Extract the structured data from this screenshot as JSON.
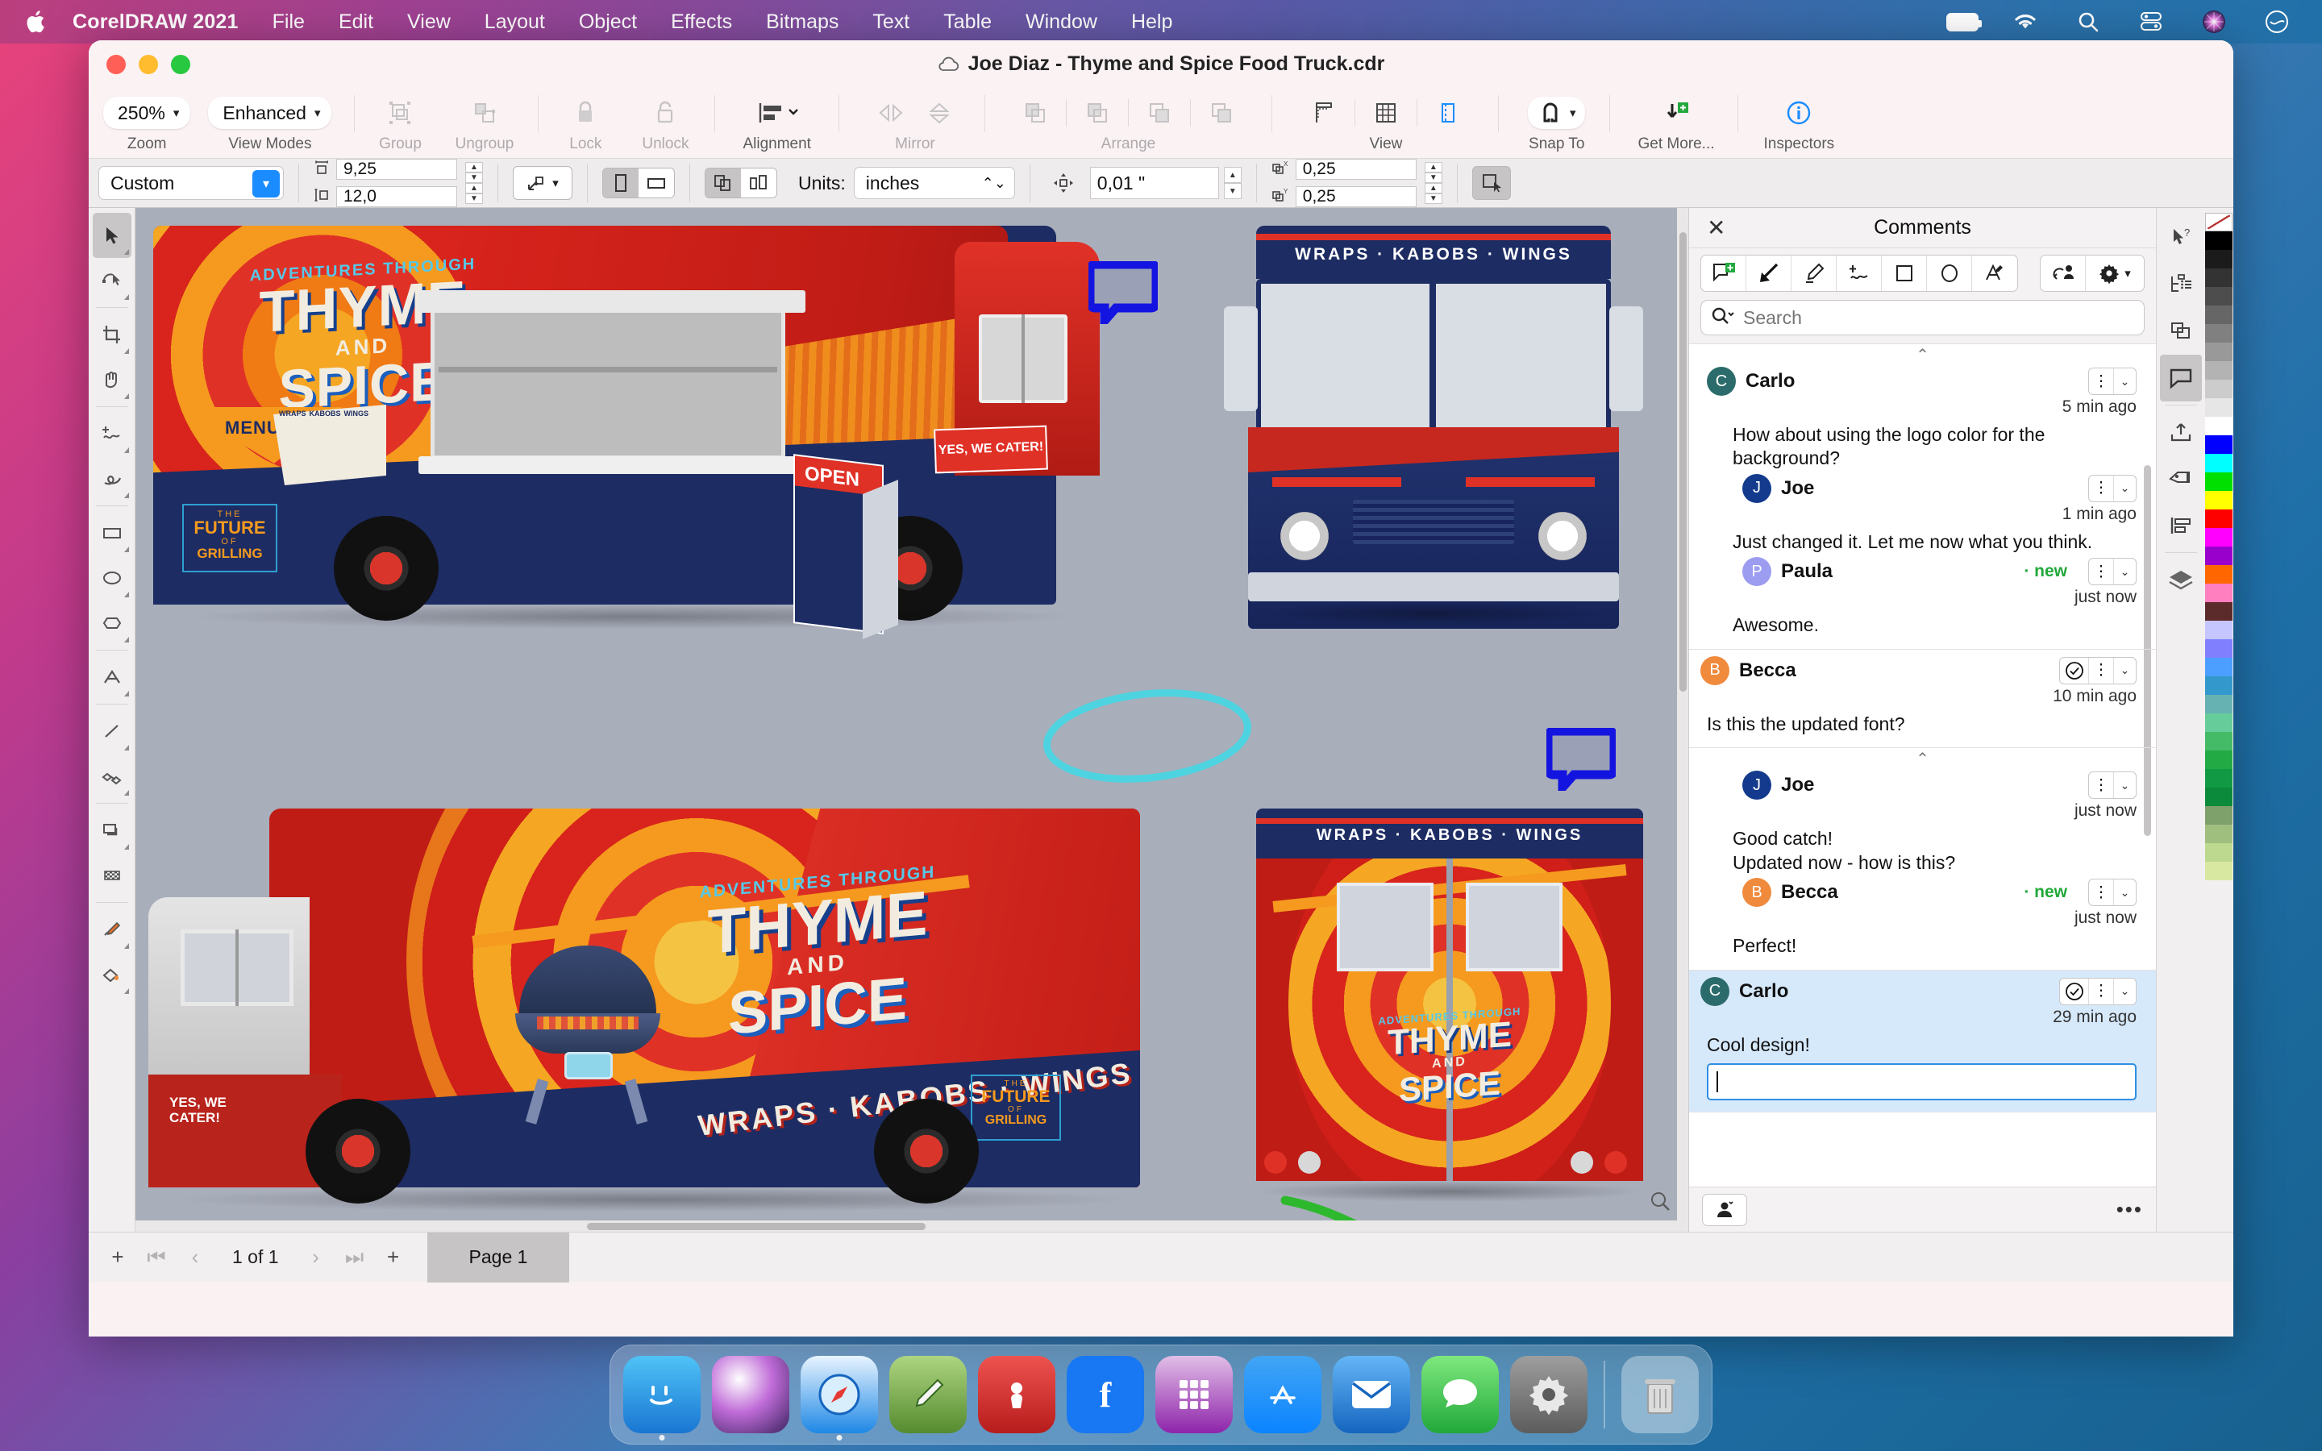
{
  "menubar": {
    "apple_icon": "apple-logo",
    "app_name": "CorelDRAW 2021",
    "items": [
      "File",
      "Edit",
      "View",
      "Layout",
      "Object",
      "Effects",
      "Bitmaps",
      "Text",
      "Table",
      "Window",
      "Help"
    ],
    "status_icons": [
      "battery-icon",
      "wifi-icon",
      "search-icon",
      "control-center-icon",
      "siri-icon",
      "notification-center-icon"
    ]
  },
  "window": {
    "title": "Joe Diaz - Thyme and Spice Food Truck.cdr",
    "cloud_icon": "cloud-icon",
    "traffic_lights": [
      "close-button",
      "minimize-button",
      "zoom-button"
    ]
  },
  "toolbar": {
    "groups": [
      {
        "label": "Zoom",
        "dim": false,
        "zoom_value": "250%"
      },
      {
        "label": "View Modes",
        "dim": false,
        "view_mode_value": "Enhanced"
      },
      {
        "label": "Group",
        "dim": true
      },
      {
        "label": "Ungroup",
        "dim": true
      },
      {
        "label": "Lock",
        "dim": true
      },
      {
        "label": "Unlock",
        "dim": true
      },
      {
        "label": "Alignment",
        "dim": false
      },
      {
        "label": "Mirror",
        "dim": true
      },
      {
        "label": "Arrange",
        "dim": true
      },
      {
        "label": "View",
        "dim": false
      },
      {
        "label": "Snap To",
        "dim": false
      },
      {
        "label": "Get More...",
        "dim": false
      },
      {
        "label": "Inspectors",
        "dim": false
      }
    ]
  },
  "propbar": {
    "page_preset": "Custom",
    "width": "9,25",
    "height": "12,0",
    "units_label": "Units:",
    "units_value": "inches",
    "nudge_value": "0,01 \"",
    "duplicate_x": "0,25",
    "duplicate_y": "0,25",
    "orientation_portrait": "portrait-icon",
    "orientation_landscape": "landscape-icon",
    "apply_all_pages": "all-pages-icon",
    "apply_current_page": "current-page-icon"
  },
  "toolbox": {
    "tools": [
      "pick-tool",
      "shape-tool",
      "crop-tool",
      "zoom-pan-tool",
      "freehand-tool",
      "smart-fill-tool",
      "rectangle-tool",
      "ellipse-tool",
      "polygon-tool",
      "text-tool",
      "line-tool",
      "parallel-dimension-tool",
      "drop-shadow-tool",
      "transparency-tool",
      "color-eyedropper-tool",
      "fill-tool"
    ]
  },
  "canvas": {
    "artwork_title": "ADVENTURES THROUGH THYME AND SPICE",
    "truck_views": [
      {
        "name": "driver-side-view",
        "headline_top": "ADVENTURES THROUGH",
        "headline_main": "THYME",
        "headline_and": "AND",
        "headline_sub": "SPICE",
        "menu_label": "MENU",
        "menu_columns": [
          "WRAPS",
          "KABOBS",
          "WINGS"
        ],
        "badge_lines": [
          "THE",
          "FUTURE",
          "OF",
          "GRILLING"
        ],
        "sign_text": "OPEN",
        "cater_text": "YES, WE CATER!"
      },
      {
        "name": "front-view",
        "banner": "WRAPS · KABOBS · WINGS"
      },
      {
        "name": "passenger-side-view",
        "headline_top": "ADVENTURES THROUGH",
        "headline_main": "THYME",
        "headline_and": "AND",
        "headline_sub": "SPICE",
        "bottom_banner": "WRAPS · KABOBS · WINGS",
        "cater_text": "YES, WE CATER!",
        "badge_lines": [
          "THE",
          "FUTURE",
          "OF",
          "GRILLING"
        ]
      },
      {
        "name": "rear-view",
        "banner": "WRAPS · KABOBS · WINGS",
        "headline_top": "ADVENTURES THROUGH",
        "headline_main": "THYME",
        "headline_and": "AND",
        "headline_sub": "SPICE"
      }
    ],
    "annotations": [
      {
        "type": "comment-marker",
        "name": "comment-marker-1"
      },
      {
        "type": "comment-marker",
        "name": "comment-marker-2"
      },
      {
        "type": "ellipse-annotation",
        "name": "cyan-ellipse-annotation",
        "color": "#4ed3e0"
      },
      {
        "type": "arrow-annotation",
        "name": "green-arrow-annotation",
        "color": "#2eb82e"
      }
    ]
  },
  "comments": {
    "panel_title": "Comments",
    "close_icon": "close-icon",
    "tools": [
      "add-comment-icon",
      "arrow-tool-icon",
      "highlighter-tool-icon",
      "freehand-tool-icon",
      "rectangle-tool-icon",
      "ellipse-tool-icon",
      "strikethrough-tool-icon"
    ],
    "share_icon": "share-with-user-icon",
    "settings_icon": "gear-icon",
    "search_placeholder": "Search",
    "search_value": "",
    "search_icon": "search-icon",
    "threads": [
      {
        "selected": false,
        "collapsed_caret": "chevron-up-icon",
        "resolve": false,
        "messages": [
          {
            "author": "Carlo",
            "initial": "C",
            "color": "#2c6b6b",
            "time": "5 min ago",
            "text": "How about using the logo color for the background?",
            "new": false,
            "indent": false
          },
          {
            "author": "Joe",
            "initial": "J",
            "color": "#133a8c",
            "time": "1 min ago",
            "text": "Just changed it. Let me now what you think.",
            "new": false,
            "indent": true
          },
          {
            "author": "Paula",
            "initial": "P",
            "color": "#9c9cf0",
            "time": "just now",
            "text": "Awesome.",
            "new": true,
            "new_label": "· new",
            "indent": true
          }
        ]
      },
      {
        "selected": false,
        "resolve": true,
        "resolve_icon": "resolve-check-icon",
        "messages": [
          {
            "author": "Becca",
            "initial": "B",
            "color": "#f08a3c",
            "time": "10 min ago",
            "text": "Is this the updated font?",
            "new": false,
            "indent": false
          }
        ]
      },
      {
        "selected": false,
        "collapsed_caret": "chevron-up-icon",
        "resolve": false,
        "messages": [
          {
            "author": "Joe",
            "initial": "J",
            "color": "#133a8c",
            "time": "just now",
            "text": "Good catch!\nUpdated now - how is this?",
            "new": false,
            "indent": true
          },
          {
            "author": "Becca",
            "initial": "B",
            "color": "#f08a3c",
            "time": "just now",
            "text": "Perfect!",
            "new": true,
            "new_label": "· new",
            "indent": true
          }
        ]
      },
      {
        "selected": true,
        "resolve": true,
        "resolve_icon": "resolve-check-icon",
        "messages": [
          {
            "author": "Carlo",
            "initial": "C",
            "color": "#2c6b6b",
            "time": "29 min ago",
            "text": "Cool design!",
            "new": false,
            "indent": false
          }
        ],
        "reply_input_value": "",
        "reply_input_focused": true
      }
    ],
    "footer_icon": "add-commenter-icon",
    "footer_overflow": "…"
  },
  "right_dockers": {
    "items": [
      "object-properties-icon",
      "object-manager-icon",
      "objects-icon",
      "comments-icon",
      "export-icon",
      "tags-icon",
      "align-distribute-icon",
      "layers-icon"
    ],
    "active": "comments-icon"
  },
  "palette": {
    "swatches": [
      "none",
      "#000000",
      "#1b1b1b",
      "#333333",
      "#4d4d4d",
      "#666666",
      "#808080",
      "#999999",
      "#b3b3b3",
      "#cccccc",
      "#e6e6e6",
      "#ffffff",
      "#0000ff",
      "#00ffff",
      "#00e000",
      "#ffff00",
      "#ff0000",
      "#ff00ff",
      "#9900cc",
      "#ff6600",
      "#ff7fbf",
      "#5b2b2b",
      "#c5c5ff",
      "#8080ff",
      "#4d9fff",
      "#3399cc",
      "#66b2b2",
      "#66cc99",
      "#44bb66",
      "#22aa44",
      "#119944",
      "#0a8a3a",
      "#7ea06a",
      "#9fbf7f",
      "#bcd98f",
      "#d9e8a0"
    ],
    "none_label": "none-swatch"
  },
  "statusbar": {
    "add_page_left": "+",
    "first_page_icon": "first-page-icon",
    "prev_page_icon": "prev-page-icon",
    "page_count": "1 of 1",
    "next_page_icon": "next-page-icon",
    "last_page_icon": "last-page-icon",
    "add_page_right": "+",
    "page_tab": "Page 1"
  },
  "dock": {
    "apps": [
      {
        "name": "finder",
        "color": "#2196f3",
        "glyph": "☺"
      },
      {
        "name": "siri",
        "color": "#b36cd8",
        "glyph": "◉"
      },
      {
        "name": "safari",
        "color": "#1e8fe6",
        "glyph": "🧭"
      },
      {
        "name": "notes",
        "color": "#8bc34a",
        "glyph": "✎"
      },
      {
        "name": "podcasts",
        "color": "#c62828",
        "glyph": "◎"
      },
      {
        "name": "facebook",
        "color": "#1877f2",
        "glyph": "f"
      },
      {
        "name": "launchpad",
        "color": "#8c52c0",
        "glyph": "▦"
      },
      {
        "name": "app-store",
        "color": "#0b84ff",
        "glyph": "A"
      },
      {
        "name": "mail",
        "color": "#1e88e5",
        "glyph": "✉"
      },
      {
        "name": "messages",
        "color": "#34c759",
        "glyph": "💬"
      },
      {
        "name": "system-settings",
        "color": "#767676",
        "glyph": "⚙"
      },
      {
        "name": "trash",
        "color": "#c8c8c8",
        "glyph": "🗑"
      }
    ]
  },
  "colors": {
    "accent_blue": "#1a8cff",
    "truck_red": "#e03127",
    "truck_orange": "#f59a1e",
    "truck_navy": "#1d2c63",
    "annotation_cyan": "#4ed3e0",
    "annotation_green": "#2eb82e",
    "comment_marker_blue": "#1414e0",
    "new_badge_green": "#22a83a"
  }
}
